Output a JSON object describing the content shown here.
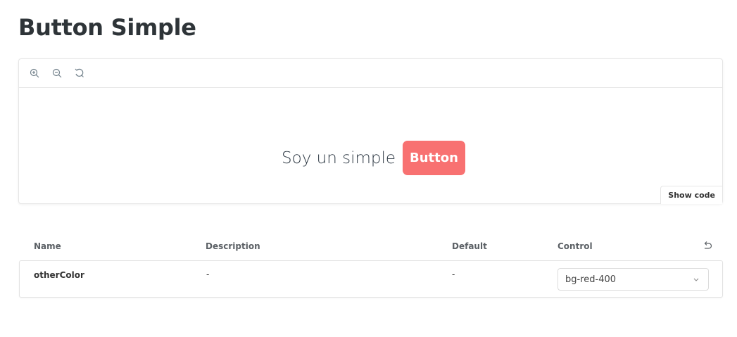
{
  "page": {
    "title": "Button Simple"
  },
  "toolbar": {
    "zoom_in_icon": "zoom-in-icon",
    "zoom_out_icon": "zoom-out-icon",
    "reset_zoom_icon": "reset-zoom-icon"
  },
  "preview": {
    "text": "Soy un simple",
    "button_label": "Button",
    "button_color": "#f87171",
    "show_code_label": "Show code"
  },
  "args_table": {
    "headers": {
      "name": "Name",
      "description": "Description",
      "default": "Default",
      "control": "Control"
    },
    "rows": [
      {
        "name": "otherColor",
        "description": "-",
        "default": "-",
        "control_value": "bg-red-400"
      }
    ]
  }
}
